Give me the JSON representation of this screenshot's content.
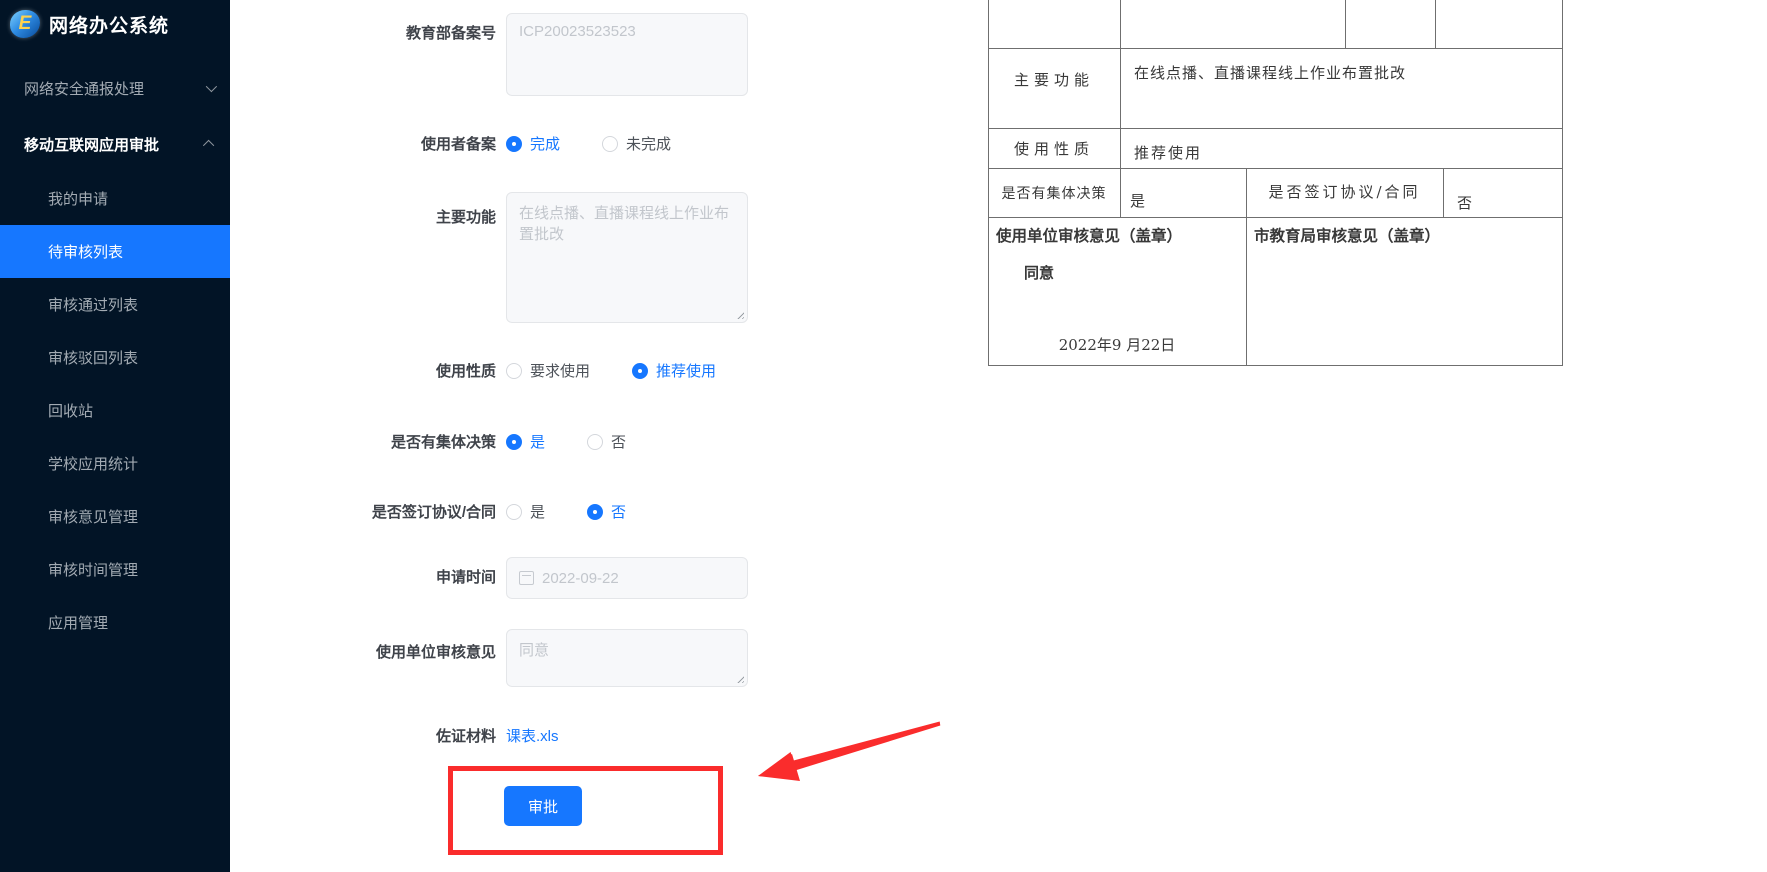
{
  "app": {
    "title": "网络办公系统"
  },
  "colors": {
    "accent": "#1677ff",
    "sidebar_bg": "#021426",
    "sidebar_active_bg": "#1677ff",
    "annotation_red": "#fa2c2c",
    "link": "#1677ff",
    "button_bg": "#1677ff"
  },
  "sidebar": {
    "groups": [
      {
        "label": "网络安全通报处理",
        "state": "collapsed"
      },
      {
        "label": "移动互联网应用审批",
        "state": "expanded"
      }
    ],
    "items": [
      {
        "label": "我的申请"
      },
      {
        "label": "待审核列表"
      },
      {
        "label": "审核通过列表"
      },
      {
        "label": "审核驳回列表"
      },
      {
        "label": "回收站"
      },
      {
        "label": "学校应用统计"
      },
      {
        "label": "审核意见管理"
      },
      {
        "label": "审核时间管理"
      },
      {
        "label": "应用管理"
      }
    ],
    "active_item": "待审核列表"
  },
  "form": {
    "record_number": {
      "label": "教育部备案号",
      "placeholder": "ICP20023523523"
    },
    "user_record": {
      "label": "使用者备案",
      "options": [
        "完成",
        "未完成"
      ],
      "selected": "完成"
    },
    "main_function": {
      "label": "主要功能",
      "placeholder": "在线点播、直播课程线上作业布置批改"
    },
    "usage_nature": {
      "label": "使用性质",
      "options": [
        "要求使用",
        "推荐使用"
      ],
      "selected": "推荐使用"
    },
    "collective_decision": {
      "label": "是否有集体决策",
      "options": [
        "是",
        "否"
      ],
      "selected": "是"
    },
    "contract_signed": {
      "label": "是否签订协议/合同",
      "options": [
        "是",
        "否"
      ],
      "selected": "否"
    },
    "apply_time": {
      "label": "申请时间",
      "value": "2022-09-22"
    },
    "unit_opinion": {
      "label": "使用单位审核意见",
      "placeholder": "同意"
    },
    "evidence": {
      "label": "佐证材料",
      "file": "课表.xls"
    },
    "approve_button": "审批"
  },
  "document_preview": {
    "rows": [
      {
        "label": "主要功能",
        "value": "在线点播、直播课程线上作业布置批改"
      },
      {
        "label": "使用性质",
        "value": "推荐使用"
      },
      {
        "label": "是否有集体决策",
        "value": "是",
        "label2": "是否签订协议/合同",
        "value2": "否"
      },
      {
        "label": "使用单位审核意见（盖章）",
        "value": "同意",
        "date": "2022年9 月22日"
      },
      {
        "label": "市教育局审核意见（盖章）"
      }
    ]
  }
}
